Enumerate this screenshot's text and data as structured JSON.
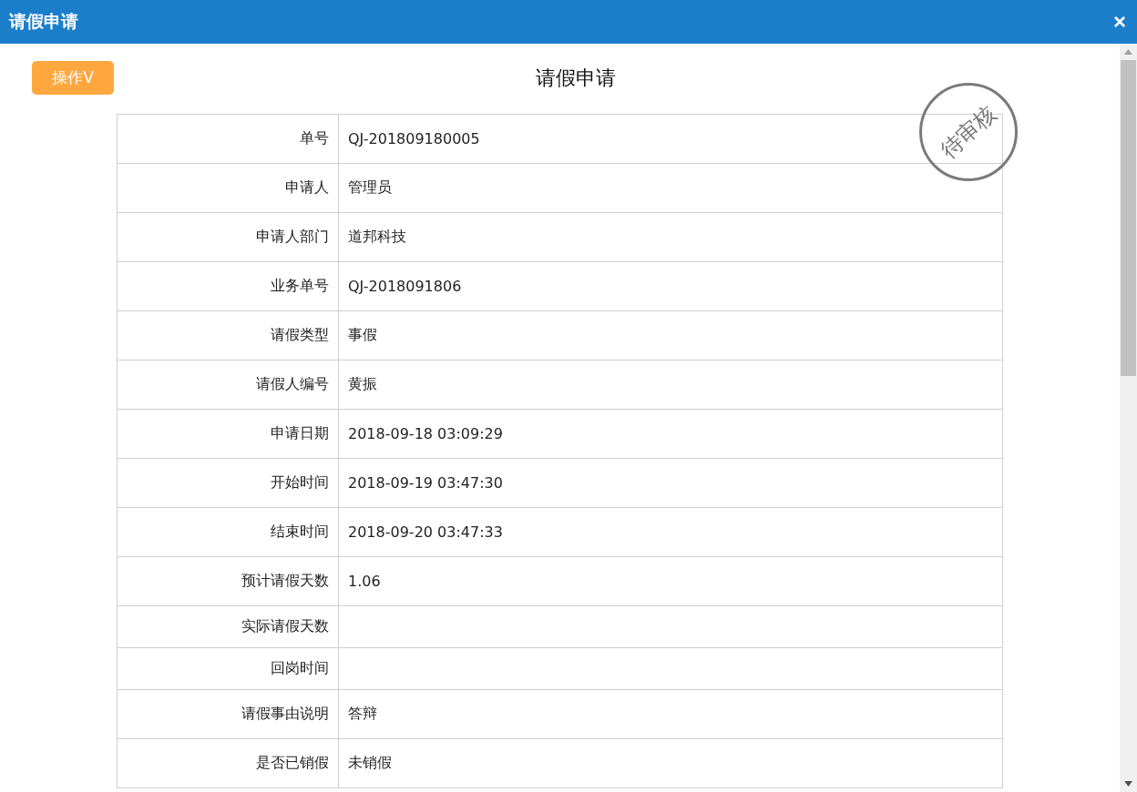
{
  "window": {
    "title": "请假申请",
    "close": "×"
  },
  "action_button": "操作V",
  "heading": "请假申请",
  "stamp": "待审核",
  "fields": [
    {
      "label": "单号",
      "value": "QJ-201809180005"
    },
    {
      "label": "申请人",
      "value": "管理员"
    },
    {
      "label": "申请人部门",
      "value": "道邦科技"
    },
    {
      "label": "业务单号",
      "value": "QJ-2018091806"
    },
    {
      "label": "请假类型",
      "value": "事假"
    },
    {
      "label": "请假人编号",
      "value": "黄振"
    },
    {
      "label": "申请日期",
      "value": "2018-09-18 03:09:29"
    },
    {
      "label": "开始时间",
      "value": "2018-09-19 03:47:30"
    },
    {
      "label": "结束时间",
      "value": "2018-09-20 03:47:33"
    },
    {
      "label": "预计请假天数",
      "value": "1.06"
    },
    {
      "label": "实际请假天数"
    },
    {
      "label": "回岗时间"
    },
    {
      "label": "请假事由说明",
      "value": "答辩"
    },
    {
      "label": "是否已销假",
      "value": "未销假"
    }
  ]
}
